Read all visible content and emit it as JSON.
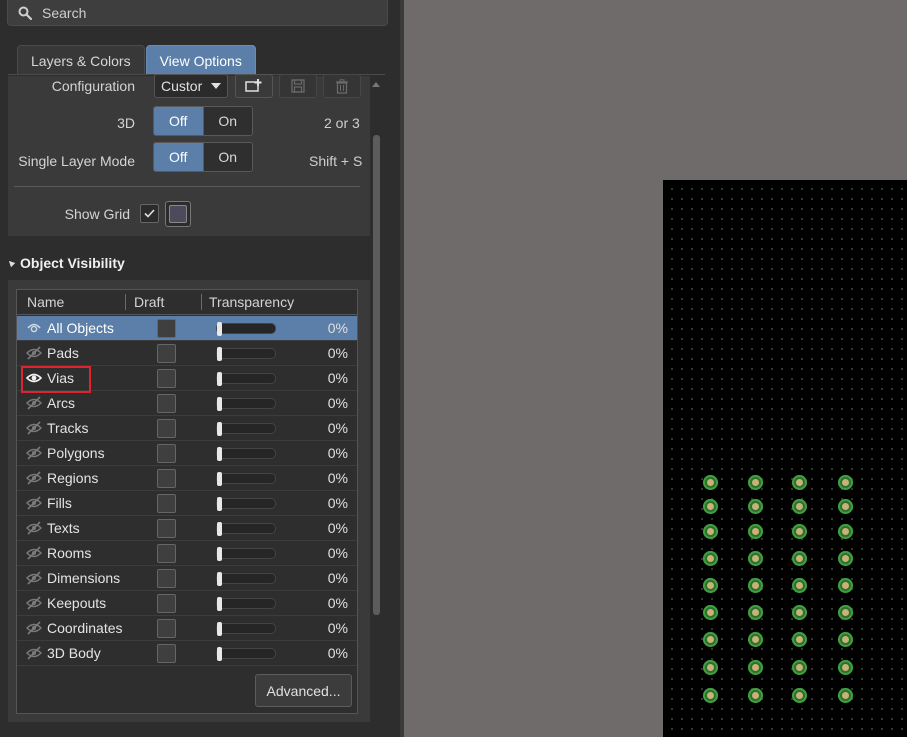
{
  "search": {
    "placeholder": "Search"
  },
  "tabs": [
    {
      "label": "Layers & Colors",
      "active": false
    },
    {
      "label": "View Options",
      "active": true
    }
  ],
  "view_options": {
    "configuration": {
      "label": "Configuration",
      "value": "Custor"
    },
    "three_d": {
      "label": "3D",
      "off": "Off",
      "on": "On",
      "selected": "Off",
      "shortcut": "2 or 3"
    },
    "single_layer": {
      "label": "Single Layer Mode",
      "off": "Off",
      "on": "On",
      "selected": "Off",
      "shortcut": "Shift + S"
    },
    "show_grid": {
      "label": "Show Grid",
      "checked": true,
      "grid_color": "#4d4a5c"
    }
  },
  "object_visibility": {
    "title": "Object Visibility",
    "columns": [
      "Name",
      "Draft",
      "Transparency"
    ],
    "rows": [
      {
        "name": "All Objects",
        "visible": "partial",
        "transparency": "0%",
        "selected": true
      },
      {
        "name": "Pads",
        "visible": false,
        "transparency": "0%"
      },
      {
        "name": "Vias",
        "visible": true,
        "transparency": "0%"
      },
      {
        "name": "Arcs",
        "visible": false,
        "transparency": "0%"
      },
      {
        "name": "Tracks",
        "visible": false,
        "transparency": "0%"
      },
      {
        "name": "Polygons",
        "visible": false,
        "transparency": "0%"
      },
      {
        "name": "Regions",
        "visible": false,
        "transparency": "0%"
      },
      {
        "name": "Fills",
        "visible": false,
        "transparency": "0%"
      },
      {
        "name": "Texts",
        "visible": false,
        "transparency": "0%"
      },
      {
        "name": "Rooms",
        "visible": false,
        "transparency": "0%"
      },
      {
        "name": "Dimensions",
        "visible": false,
        "transparency": "0%"
      },
      {
        "name": "Keepouts",
        "visible": false,
        "transparency": "0%"
      },
      {
        "name": "Coordinates",
        "visible": false,
        "transparency": "0%"
      },
      {
        "name": "3D Body",
        "visible": false,
        "transparency": "0%"
      }
    ],
    "advanced_label": "Advanced..."
  },
  "colors": {
    "accent": "#5b7fa8",
    "highlight": "#e0232e",
    "pcb_background": "#000000",
    "via_ring": "#3fa03f",
    "via_hole": "#c9b27a"
  }
}
